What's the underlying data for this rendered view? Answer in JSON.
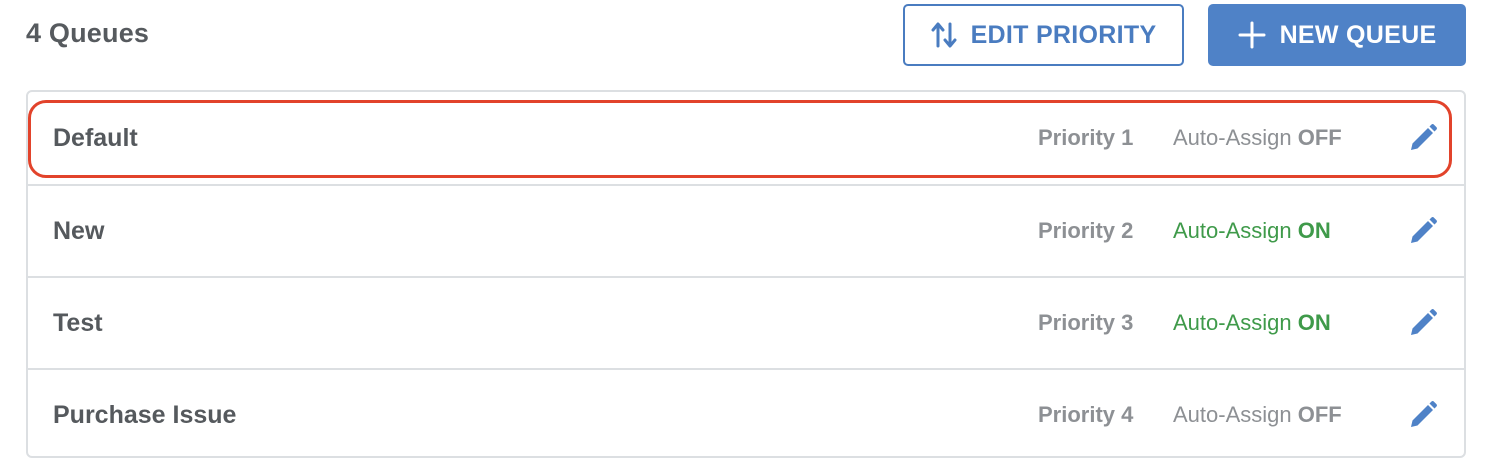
{
  "header": {
    "queue_count": "4 Queues"
  },
  "toolbar": {
    "edit_priority_label": "EDIT PRIORITY",
    "edit_priority_icon": "sort-arrows-icon",
    "new_queue_label": "NEW QUEUE",
    "new_queue_icon": "plus-icon"
  },
  "colors": {
    "accent": "#4f82c7",
    "auto_on": "#3f9a4a",
    "auto_off": "#8d9094",
    "highlight": "#e2432b"
  },
  "queues": [
    {
      "name": "Default",
      "priority": "Priority 1",
      "auto_label": "Auto-Assign",
      "auto_state": "OFF",
      "highlighted": true
    },
    {
      "name": "New",
      "priority": "Priority 2",
      "auto_label": "Auto-Assign",
      "auto_state": "ON"
    },
    {
      "name": "Test",
      "priority": "Priority 3",
      "auto_label": "Auto-Assign",
      "auto_state": "ON"
    },
    {
      "name": "Purchase Issue",
      "priority": "Priority 4",
      "auto_label": "Auto-Assign",
      "auto_state": "OFF"
    }
  ]
}
